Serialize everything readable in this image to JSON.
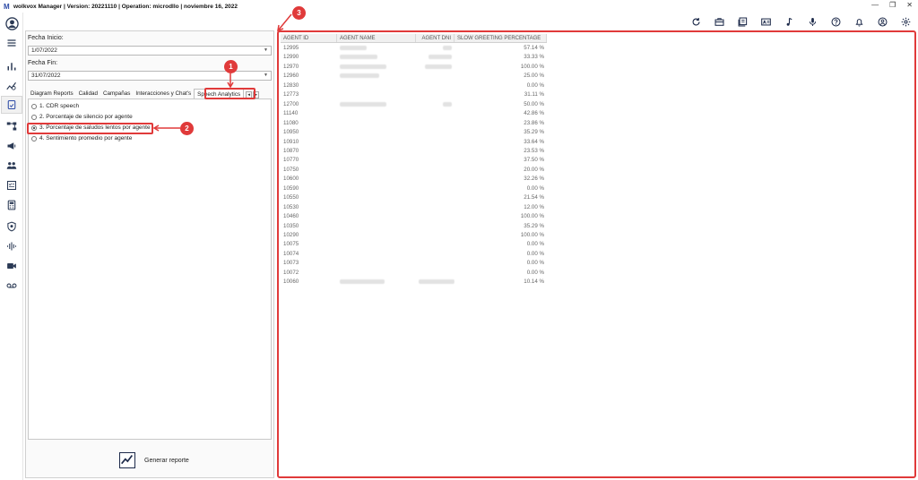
{
  "window": {
    "title": "wolkvox Manager  | Version: 20221110 |  Operation: microdllo | noviembre 16, 2022",
    "logo_letter": "M",
    "controls": [
      "—",
      "❐",
      "✕"
    ]
  },
  "sidebar": {
    "items": [
      {
        "icon": "user-avatar-icon"
      },
      {
        "icon": "menu-icon"
      },
      {
        "icon": "bar-chart-icon"
      },
      {
        "icon": "analytics-icon"
      },
      {
        "icon": "reports-icon",
        "active": true
      },
      {
        "icon": "flow-icon"
      },
      {
        "icon": "campaign-icon"
      },
      {
        "icon": "users-group-icon"
      },
      {
        "icon": "checklist-icon"
      },
      {
        "icon": "calculator-icon"
      },
      {
        "icon": "shield-icon"
      },
      {
        "icon": "audio-wave-icon"
      },
      {
        "icon": "video-icon"
      },
      {
        "icon": "voicemail-icon"
      }
    ]
  },
  "toolbar": {
    "icons": [
      "refresh-icon",
      "briefcase-icon",
      "book-icon",
      "contact-card-icon",
      "music-note-icon",
      "microphone-icon",
      "help-icon",
      "bell-icon",
      "account-icon",
      "settings-icon"
    ]
  },
  "filters": {
    "start_label": "Fecha Inicio:",
    "start_value": "1/07/2022",
    "end_label": "Fecha Fin:",
    "end_value": "31/07/2022"
  },
  "tabs": {
    "items": [
      "Diagram Reports",
      "Calidad",
      "Campañas",
      "Interacciones y Chat's",
      "Speech Analytics"
    ],
    "selected": "Speech Analytics",
    "prev": "◂",
    "next": "▸"
  },
  "report_options": [
    {
      "label": "1. CDR speech",
      "checked": false
    },
    {
      "label": "2. Porcentaje de silencio por agente",
      "checked": false
    },
    {
      "label": "3. Porcentaje de saludos lentos por agente",
      "checked": true
    },
    {
      "label": "4. Sentimiento promedio por agente",
      "checked": false
    }
  ],
  "generate": {
    "label": "Generar reporte"
  },
  "table": {
    "columns": [
      "AGENT ID",
      "AGENT NAME",
      "AGENT DNI",
      "SLOW GREETING PERCENTAGE"
    ],
    "rows": [
      {
        "id": "12995",
        "pct": "57.14 %",
        "name_w": 30,
        "dni_w": 10
      },
      {
        "id": "12990",
        "pct": "33.33 %",
        "name_w": 42,
        "dni_w": 26
      },
      {
        "id": "12970",
        "pct": "100.00 %",
        "name_w": 52,
        "dni_w": 30
      },
      {
        "id": "12960",
        "pct": "25.00 %",
        "name_w": 44,
        "dni_w": 0
      },
      {
        "id": "12830",
        "pct": "0.00 %",
        "name_w": 0,
        "dni_w": 0
      },
      {
        "id": "12773",
        "pct": "31.11 %",
        "name_w": 0,
        "dni_w": 0
      },
      {
        "id": "12700",
        "pct": "50.00 %",
        "name_w": 52,
        "dni_w": 10
      },
      {
        "id": "11140",
        "pct": "42.86 %",
        "name_w": 0,
        "dni_w": 0
      },
      {
        "id": "11080",
        "pct": "23.86 %",
        "name_w": 0,
        "dni_w": 0
      },
      {
        "id": "10950",
        "pct": "35.29 %",
        "name_w": 0,
        "dni_w": 0
      },
      {
        "id": "10910",
        "pct": "33.64 %",
        "name_w": 0,
        "dni_w": 0
      },
      {
        "id": "10870",
        "pct": "23.53 %",
        "name_w": 0,
        "dni_w": 0
      },
      {
        "id": "10770",
        "pct": "37.50 %",
        "name_w": 0,
        "dni_w": 0
      },
      {
        "id": "10750",
        "pct": "20.00 %",
        "name_w": 0,
        "dni_w": 0
      },
      {
        "id": "10600",
        "pct": "32.26 %",
        "name_w": 0,
        "dni_w": 0
      },
      {
        "id": "10590",
        "pct": "0.00 %",
        "name_w": 0,
        "dni_w": 0
      },
      {
        "id": "10550",
        "pct": "21.54 %",
        "name_w": 0,
        "dni_w": 0
      },
      {
        "id": "10530",
        "pct": "12.00 %",
        "name_w": 0,
        "dni_w": 0
      },
      {
        "id": "10460",
        "pct": "100.00 %",
        "name_w": 0,
        "dni_w": 0
      },
      {
        "id": "10350",
        "pct": "35.29 %",
        "name_w": 0,
        "dni_w": 0
      },
      {
        "id": "10290",
        "pct": "100.00 %",
        "name_w": 0,
        "dni_w": 0
      },
      {
        "id": "10075",
        "pct": "0.00 %",
        "name_w": 0,
        "dni_w": 0
      },
      {
        "id": "10074",
        "pct": "0.00 %",
        "name_w": 0,
        "dni_w": 0
      },
      {
        "id": "10073",
        "pct": "0.00 %",
        "name_w": 0,
        "dni_w": 0
      },
      {
        "id": "10072",
        "pct": "0.00 %",
        "name_w": 0,
        "dni_w": 0
      },
      {
        "id": "10060",
        "pct": "10.14 %",
        "name_w": 50,
        "dni_w": 40
      }
    ]
  },
  "annotations": {
    "badge1": "1",
    "badge2": "2",
    "badge3": "3",
    "color": "#e03a3a"
  }
}
